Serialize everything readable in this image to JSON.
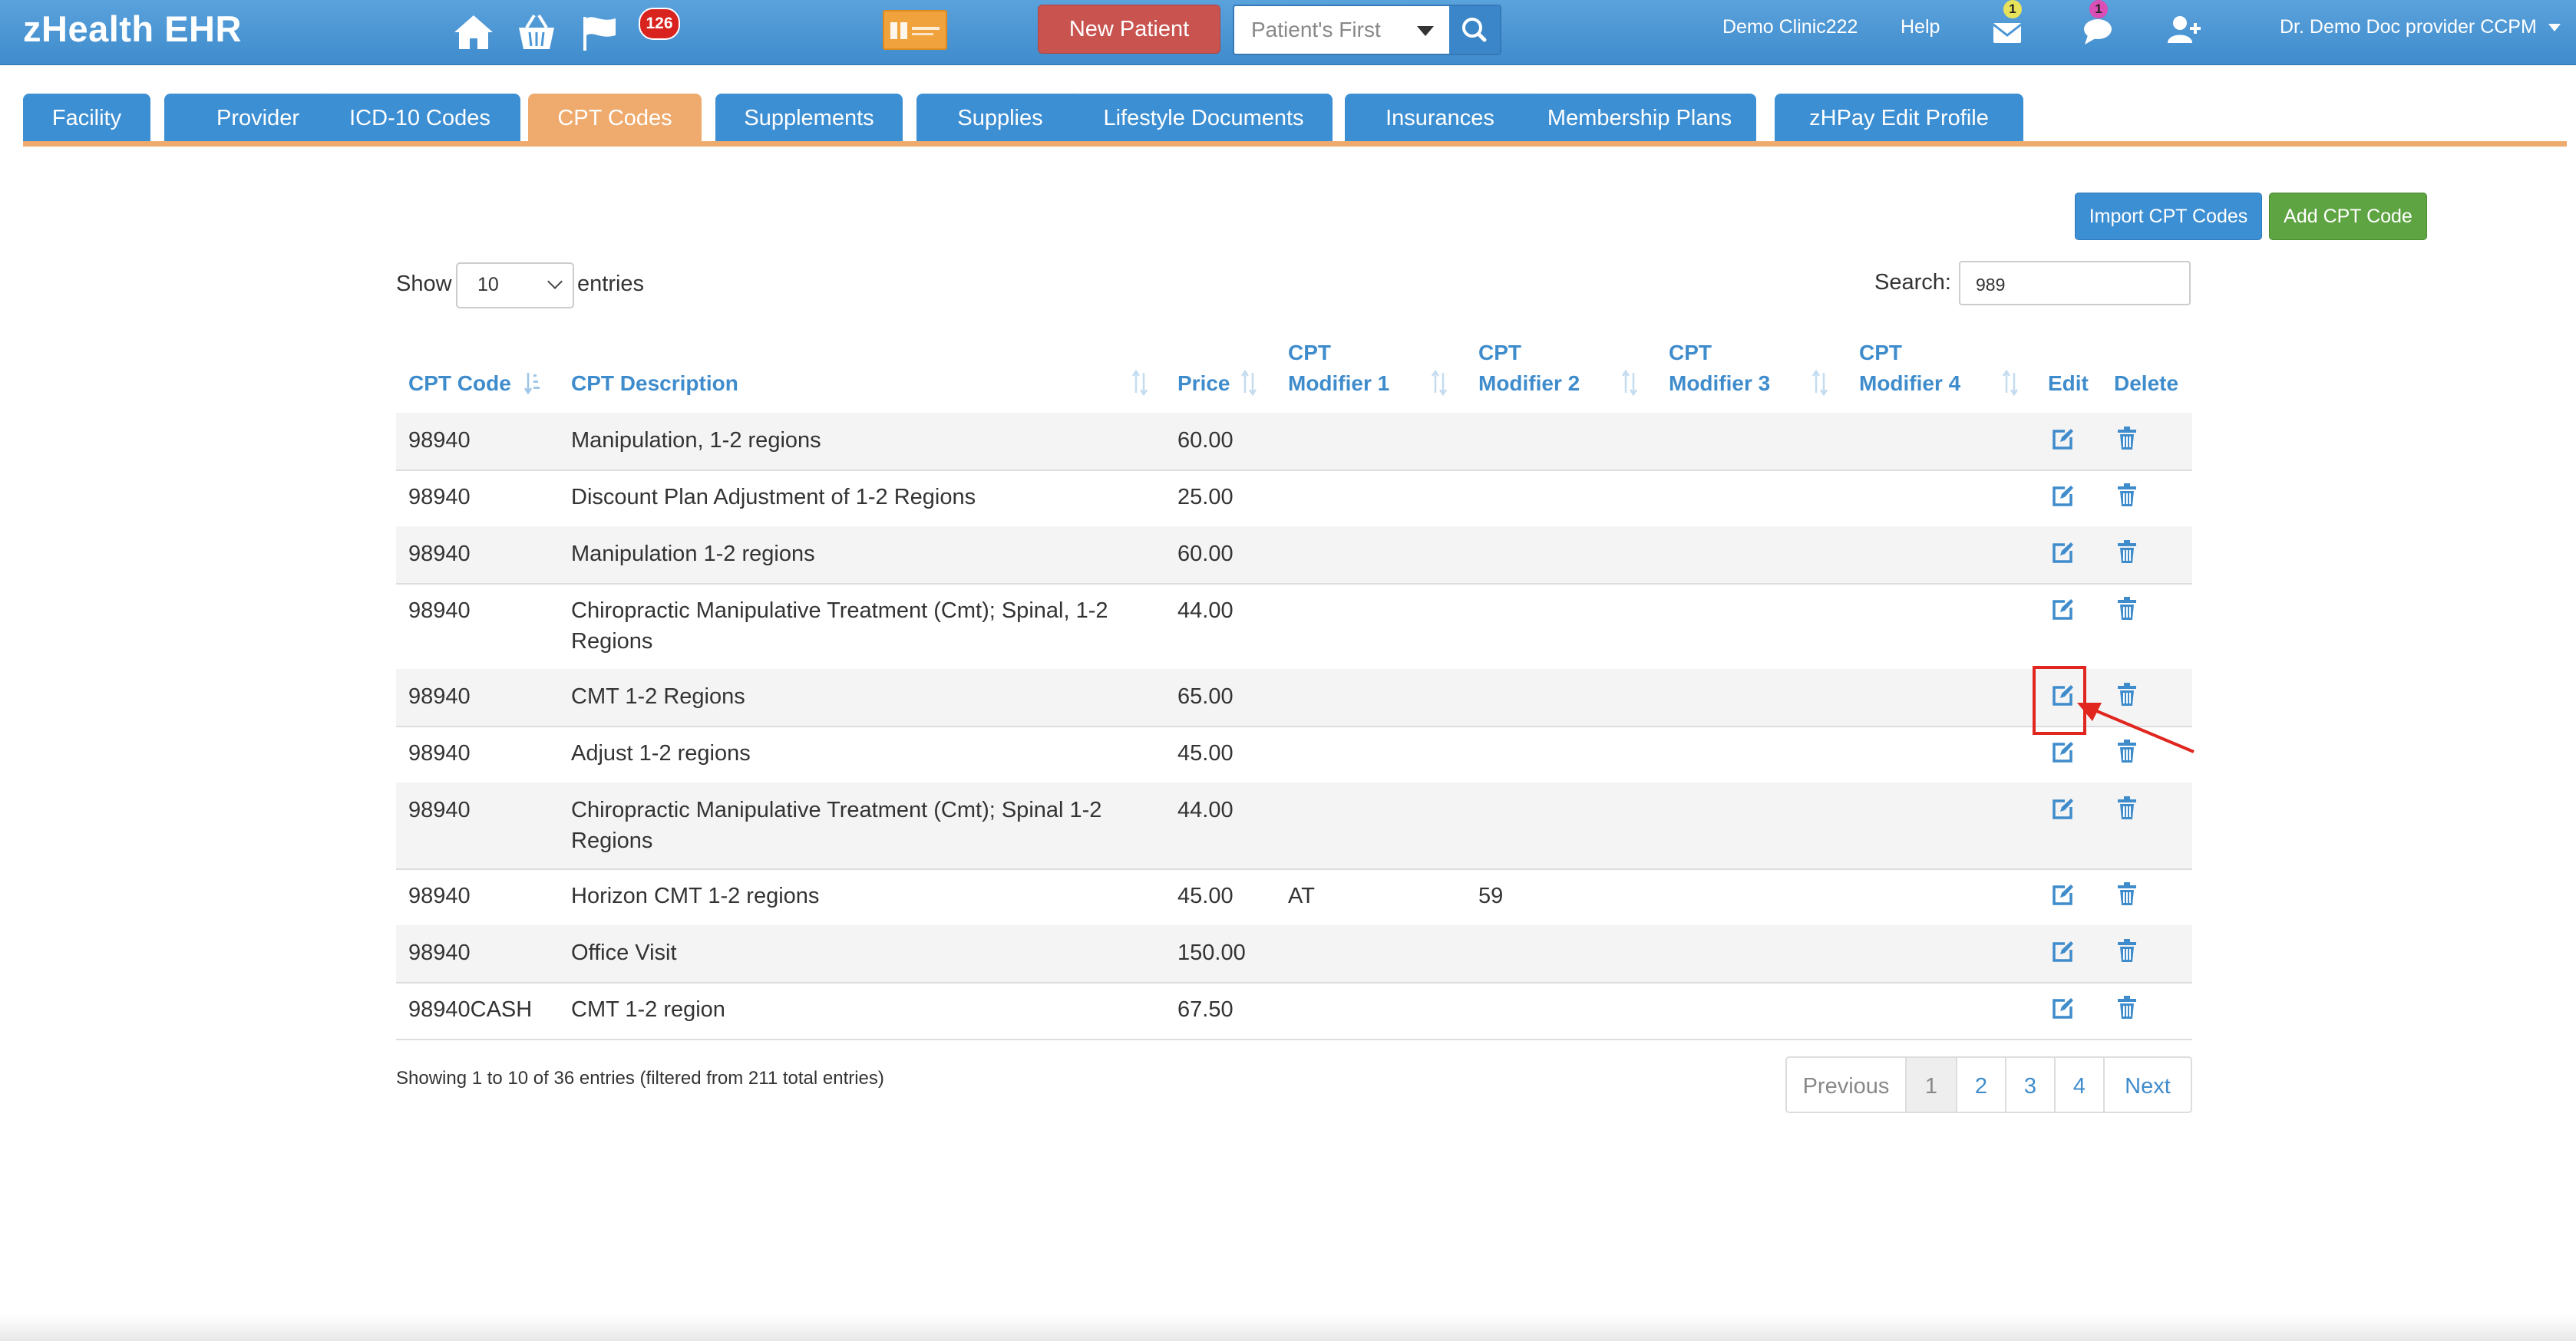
{
  "topbar": {
    "brand": "zHealth EHR",
    "badge_count": "126",
    "new_patient_label": "New Patient",
    "search_placeholder": "Patient's First",
    "clinic": "Demo Clinic222",
    "help": "Help",
    "mail_badge": "1",
    "chat_badge": "1",
    "user": "Dr. Demo Doc provider CCPM"
  },
  "tabs": [
    {
      "label": "Facility",
      "active": false
    },
    {
      "label": "Provider",
      "active": false
    },
    {
      "label": "ICD-10 Codes",
      "active": false
    },
    {
      "label": "CPT Codes",
      "active": true
    },
    {
      "label": "Supplements",
      "active": false
    },
    {
      "label": "Supplies",
      "active": false
    },
    {
      "label": "Lifestyle Documents",
      "active": false
    },
    {
      "label": "Insurances",
      "active": false
    },
    {
      "label": "Membership Plans",
      "active": false
    },
    {
      "label": "zHPay Edit Profile",
      "active": false
    }
  ],
  "actions": {
    "import_label": "Import CPT Codes",
    "add_label": "Add CPT Code"
  },
  "controls": {
    "show_label": "Show",
    "page_size": "10",
    "entries_label": "entries",
    "search_label": "Search:",
    "search_value": "989"
  },
  "table": {
    "headers": {
      "code": "CPT Code",
      "desc": "CPT Description",
      "price": "Price",
      "mod1a": "CPT",
      "mod1b": "Modifier 1",
      "mod2a": "CPT",
      "mod2b": "Modifier 2",
      "mod3a": "CPT",
      "mod3b": "Modifier 3",
      "mod4a": "CPT",
      "mod4b": "Modifier 4",
      "edit": "Edit",
      "delete": "Delete"
    },
    "rows": [
      {
        "code": "98940",
        "desc": "Manipulation, 1-2 regions",
        "desc2": "",
        "price": "60.00",
        "m1": "",
        "m2": "",
        "m3": "",
        "m4": ""
      },
      {
        "code": "98940",
        "desc": "Discount Plan Adjustment of 1-2 Regions",
        "desc2": "",
        "price": "25.00",
        "m1": "",
        "m2": "",
        "m3": "",
        "m4": ""
      },
      {
        "code": "98940",
        "desc": "Manipulation 1-2 regions",
        "desc2": "",
        "price": "60.00",
        "m1": "",
        "m2": "",
        "m3": "",
        "m4": ""
      },
      {
        "code": "98940",
        "desc": "Chiropractic Manipulative Treatment (Cmt); Spinal, 1-2",
        "desc2": "Regions",
        "price": "44.00",
        "m1": "",
        "m2": "",
        "m3": "",
        "m4": ""
      },
      {
        "code": "98940",
        "desc": "CMT 1-2 Regions",
        "desc2": "",
        "price": "65.00",
        "m1": "",
        "m2": "",
        "m3": "",
        "m4": ""
      },
      {
        "code": "98940",
        "desc": "Adjust 1-2 regions",
        "desc2": "",
        "price": "45.00",
        "m1": "",
        "m2": "",
        "m3": "",
        "m4": ""
      },
      {
        "code": "98940",
        "desc": "Chiropractic Manipulative Treatment (Cmt); Spinal 1-2",
        "desc2": "Regions",
        "price": "44.00",
        "m1": "",
        "m2": "",
        "m3": "",
        "m4": ""
      },
      {
        "code": "98940",
        "desc": "Horizon CMT 1-2 regions",
        "desc2": "",
        "price": "45.00",
        "m1": "AT",
        "m2": "59",
        "m3": "",
        "m4": ""
      },
      {
        "code": "98940",
        "desc": "Office Visit",
        "desc2": "",
        "price": "150.00",
        "m1": "",
        "m2": "",
        "m3": "",
        "m4": ""
      },
      {
        "code": "98940CASH",
        "desc": "CMT 1-2 region",
        "desc2": "",
        "price": "67.50",
        "m1": "",
        "m2": "",
        "m3": "",
        "m4": ""
      }
    ]
  },
  "footer": {
    "info": "Showing 1 to 10 of 36 entries (filtered from 211 total entries)",
    "previous": "Previous",
    "pages": [
      "1",
      "2",
      "3",
      "4"
    ],
    "next": "Next"
  },
  "colors": {
    "topbar": "#4a96d6",
    "tab": "#3d8fd3",
    "tab_active": "#efaa6d",
    "header_text": "#3f8ccc",
    "new_patient": "#c9534f",
    "add_button": "#5fa443",
    "highlight": "#e0261f"
  }
}
